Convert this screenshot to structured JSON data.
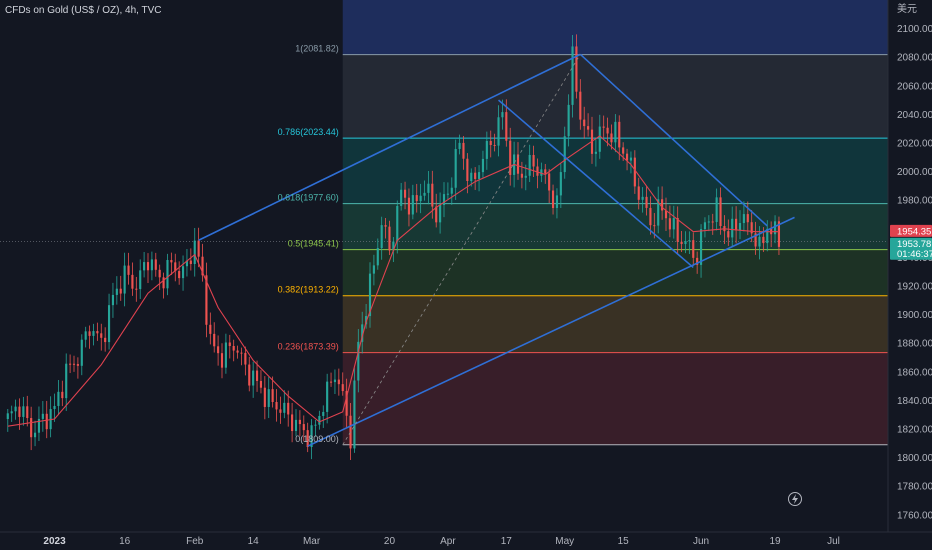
{
  "header": {
    "title": "CFDs on Gold (US$ / OZ), 4h, TVC"
  },
  "chart_data": {
    "type": "candlestick",
    "title": "CFDs on Gold (US$ / OZ), 4h, TVC",
    "y_axis": {
      "unit": "美元",
      "range": [
        1748,
        2120
      ],
      "ticks": [
        1760,
        1780,
        1800,
        1820,
        1840,
        1860,
        1880,
        1900,
        1920,
        1940,
        1960,
        1980,
        2000,
        2020,
        2040,
        2060,
        2080,
        2100
      ],
      "tick_labels": [
        "1760.00",
        "1780.00",
        "1800.00",
        "1820.00",
        "1840.00",
        "1860.00",
        "1880.00",
        "1900.00",
        "1920.00",
        "1940.00",
        "1960.00",
        "1980.00",
        "2000.00",
        "2020.00",
        "2040.00",
        "2060.00",
        "2080.00",
        "2100.00"
      ]
    },
    "x_axis": {
      "ticks": [
        "2023",
        "16",
        "Feb",
        "14",
        "Mar",
        "20",
        "Apr",
        "17",
        "May",
        "15",
        "Jun",
        "19",
        "Jul"
      ],
      "tick_index": [
        12,
        30,
        48,
        63,
        78,
        98,
        113,
        128,
        143,
        158,
        178,
        197,
        212
      ],
      "bold_ticks": [
        "2023"
      ]
    },
    "series": [
      {
        "name": "",
        "color_up": "#26a69a",
        "color_down": "#ef5350",
        "points": [
          [
            0,
            1827
          ],
          [
            3,
            1837
          ],
          [
            6,
            1818
          ],
          [
            9,
            1826
          ],
          [
            12,
            1834
          ],
          [
            15,
            1860
          ],
          [
            18,
            1870
          ],
          [
            21,
            1892
          ],
          [
            24,
            1880
          ],
          [
            27,
            1912
          ],
          [
            30,
            1928
          ],
          [
            33,
            1920
          ],
          [
            36,
            1940
          ],
          [
            39,
            1924
          ],
          [
            42,
            1935
          ],
          [
            45,
            1928
          ],
          [
            48,
            1950
          ],
          [
            50,
            1925
          ],
          [
            52,
            1880
          ],
          [
            55,
            1870
          ],
          [
            58,
            1880
          ],
          [
            61,
            1863
          ],
          [
            64,
            1852
          ],
          [
            67,
            1840
          ],
          [
            70,
            1835
          ],
          [
            73,
            1826
          ],
          [
            76,
            1818
          ],
          [
            78,
            1815
          ],
          [
            81,
            1838
          ],
          [
            84,
            1860
          ],
          [
            86,
            1842
          ],
          [
            88,
            1815
          ],
          [
            90,
            1880
          ],
          [
            93,
            1920
          ],
          [
            96,
            1965
          ],
          [
            98,
            1945
          ],
          [
            101,
            1985
          ],
          [
            104,
            1975
          ],
          [
            107,
            1990
          ],
          [
            110,
            1970
          ],
          [
            113,
            1985
          ],
          [
            116,
            2020
          ],
          [
            119,
            1990
          ],
          [
            122,
            2010
          ],
          [
            125,
            2025
          ],
          [
            127,
            2040
          ],
          [
            129,
            2005
          ],
          [
            132,
            1998
          ],
          [
            135,
            2006
          ],
          [
            138,
            1995
          ],
          [
            141,
            1975
          ],
          [
            144,
            2052
          ],
          [
            145,
            2078
          ],
          [
            147,
            2040
          ],
          [
            150,
            2015
          ],
          [
            153,
            2030
          ],
          [
            156,
            2025
          ],
          [
            159,
            2010
          ],
          [
            162,
            1985
          ],
          [
            165,
            1965
          ],
          [
            168,
            1975
          ],
          [
            171,
            1958
          ],
          [
            174,
            1950
          ],
          [
            177,
            1940
          ],
          [
            179,
            1965
          ],
          [
            182,
            1972
          ],
          [
            185,
            1955
          ],
          [
            188,
            1968
          ],
          [
            191,
            1960
          ],
          [
            193,
            1945
          ],
          [
            195,
            1962
          ],
          [
            198,
            1953
          ]
        ]
      },
      {
        "name": "",
        "color": "#e0424f",
        "points": [
          [
            0,
            1822
          ],
          [
            12,
            1827
          ],
          [
            24,
            1865
          ],
          [
            36,
            1915
          ],
          [
            48,
            1942
          ],
          [
            54,
            1905
          ],
          [
            63,
            1868
          ],
          [
            72,
            1843
          ],
          [
            80,
            1825
          ],
          [
            86,
            1832
          ],
          [
            92,
            1895
          ],
          [
            100,
            1952
          ],
          [
            110,
            1975
          ],
          [
            120,
            1993
          ],
          [
            130,
            2005
          ],
          [
            138,
            1998
          ],
          [
            144,
            2010
          ],
          [
            152,
            2025
          ],
          [
            160,
            2005
          ],
          [
            168,
            1975
          ],
          [
            176,
            1958
          ],
          [
            184,
            1960
          ],
          [
            192,
            1958
          ],
          [
            198,
            1958
          ]
        ]
      }
    ],
    "fibonacci": {
      "x_range_index": [
        86,
        222
      ],
      "levels": [
        {
          "ratio": "1",
          "value": 2081.82,
          "label": "1(2081.82)",
          "color": "#8a9ba8",
          "fill": "#1e2d5c"
        },
        {
          "ratio": "0.786",
          "value": 2023.44,
          "label": "0.786(2023.44)",
          "color": "#26c6da",
          "fill": "#252a36"
        },
        {
          "ratio": "0.618",
          "value": 1977.6,
          "label": "0.618(1977.60)",
          "color": "#4db6ac",
          "fill": "#10373d"
        },
        {
          "ratio": "0.5",
          "value": 1945.41,
          "label": "0.5(1945.41)",
          "color": "#8bc34a",
          "fill": "#173a36"
        },
        {
          "ratio": "0.382",
          "value": 1913.22,
          "label": "0.382(1913.22)",
          "color": "#ffb300",
          "fill": "#1d3426"
        },
        {
          "ratio": "0.236",
          "value": 1873.39,
          "label": "0.236(1873.39)",
          "color": "#ef5350",
          "fill": "#3b3325"
        },
        {
          "ratio": "0",
          "value": 1809.0,
          "label": "0(1809.00)",
          "color": "#b2b5be",
          "fill": "#3a1f2a"
        }
      ]
    },
    "trendlines": [
      {
        "name": "channel-upper",
        "color": "#2f6fd6",
        "points": [
          [
            49,
            1952
          ],
          [
            147,
            2082
          ]
        ]
      },
      {
        "name": "channel-lower",
        "color": "#2f6fd6",
        "points": [
          [
            77,
            1808
          ],
          [
            202,
            1968
          ]
        ]
      },
      {
        "name": "down-upper",
        "color": "#2f6fd6",
        "points": [
          [
            147,
            2082
          ],
          [
            195,
            1962
          ]
        ]
      },
      {
        "name": "down-lower",
        "color": "#2f6fd6",
        "points": [
          [
            126,
            2050
          ],
          [
            176,
            1933
          ]
        ]
      },
      {
        "name": "fib-diagonal",
        "color": "#8a8a8a",
        "dashed": true,
        "points": [
          [
            86,
            1809
          ],
          [
            147,
            2082
          ]
        ]
      }
    ],
    "price_badges": [
      {
        "price": "1954.35",
        "value": 1954.35,
        "color": "#e0424f"
      },
      {
        "price": "1953.78",
        "value": 1953.78,
        "color": "#26a69a",
        "countdown": "01:46:37"
      }
    ],
    "horizontal_line": {
      "value": 1951
    },
    "grid": false
  }
}
